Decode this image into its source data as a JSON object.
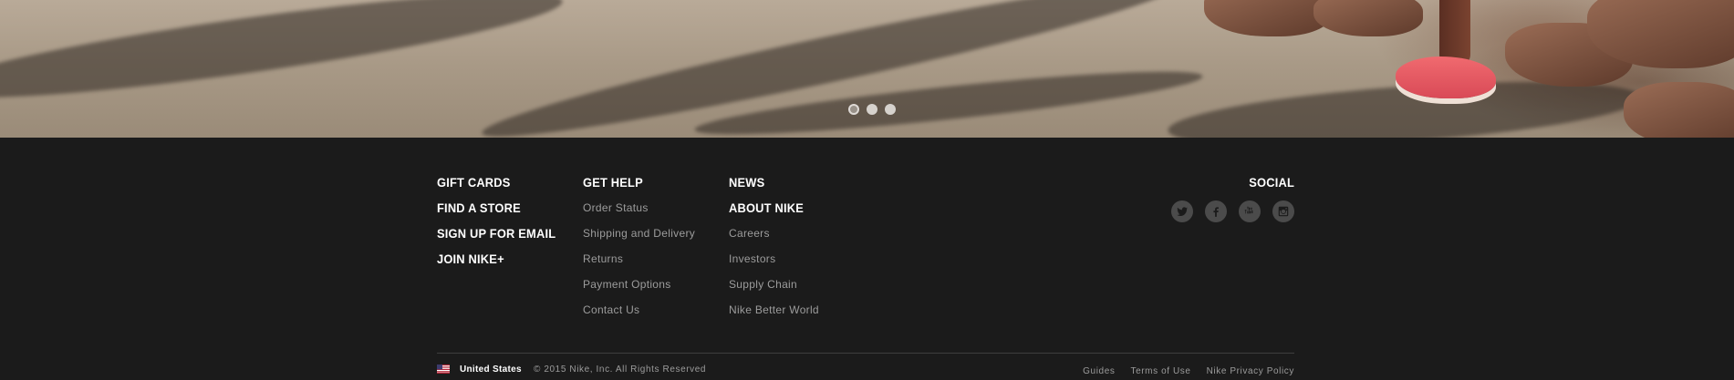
{
  "hero": {
    "carousel_slides": 3,
    "active_slide": 1
  },
  "footer": {
    "col1": [
      "GIFT CARDS",
      "FIND A STORE",
      "SIGN UP FOR EMAIL",
      "JOIN NIKE+"
    ],
    "col2": {
      "heading": "GET HELP",
      "links": [
        "Order Status",
        "Shipping and Delivery",
        "Returns",
        "Payment Options",
        "Contact Us"
      ]
    },
    "col3": {
      "heading1": "NEWS",
      "heading2": "ABOUT NIKE",
      "links": [
        "Careers",
        "Investors",
        "Supply Chain",
        "Nike Better World"
      ]
    },
    "social": {
      "heading": "SOCIAL",
      "icons": [
        "twitter-icon",
        "facebook-icon",
        "youtube-icon",
        "instagram-icon"
      ]
    },
    "bottom": {
      "country": "United States",
      "copyright": "© 2015 Nike, Inc. All Rights Reserved",
      "legal": [
        "Guides",
        "Terms of Use",
        "Nike Privacy Policy"
      ]
    }
  },
  "colors": {
    "footer_bg": "#1b1b1b",
    "heading": "#ffffff",
    "link": "#9c9c9c",
    "social_icon": "#4b4b4b"
  }
}
